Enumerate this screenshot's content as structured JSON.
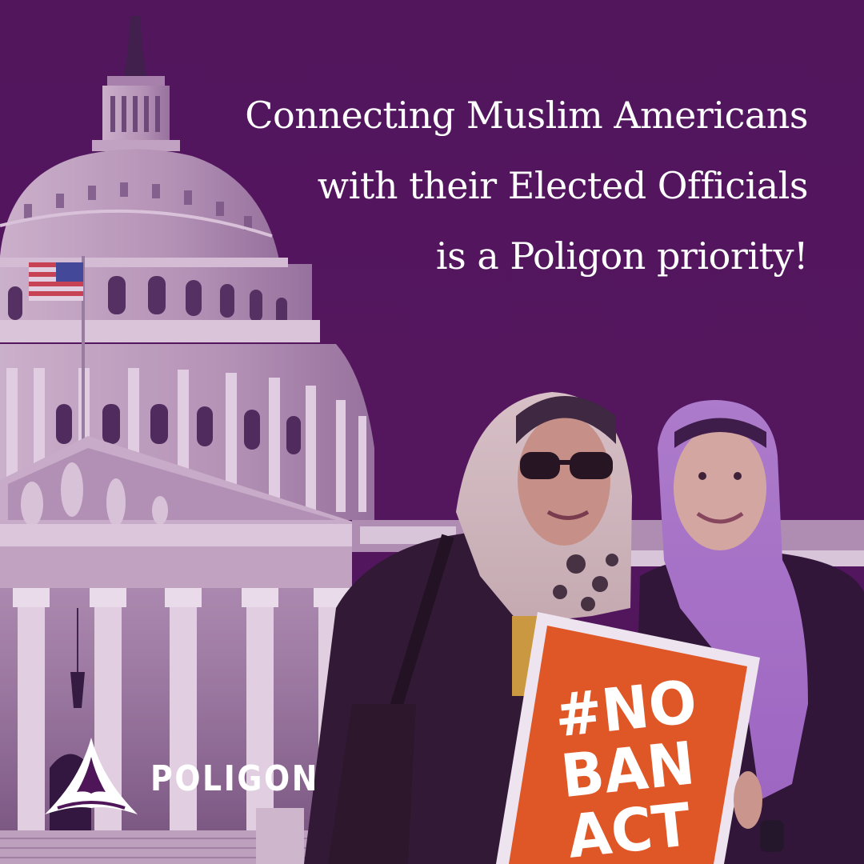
{
  "headline": {
    "line1": "Connecting Muslim Americans",
    "line2": "with their Elected Officials",
    "line3": "is a Poligon priority!"
  },
  "logo": {
    "wordmark": "POLIGON",
    "icon": "poligon-mark-icon"
  },
  "sign": {
    "line1": "#NO",
    "line2": "BAN",
    "line3": "ACT"
  },
  "colors": {
    "background": "#4f1559",
    "text": "#ffffff",
    "sign": "#ef5f1b",
    "building_tint": "#c3a8c6"
  }
}
